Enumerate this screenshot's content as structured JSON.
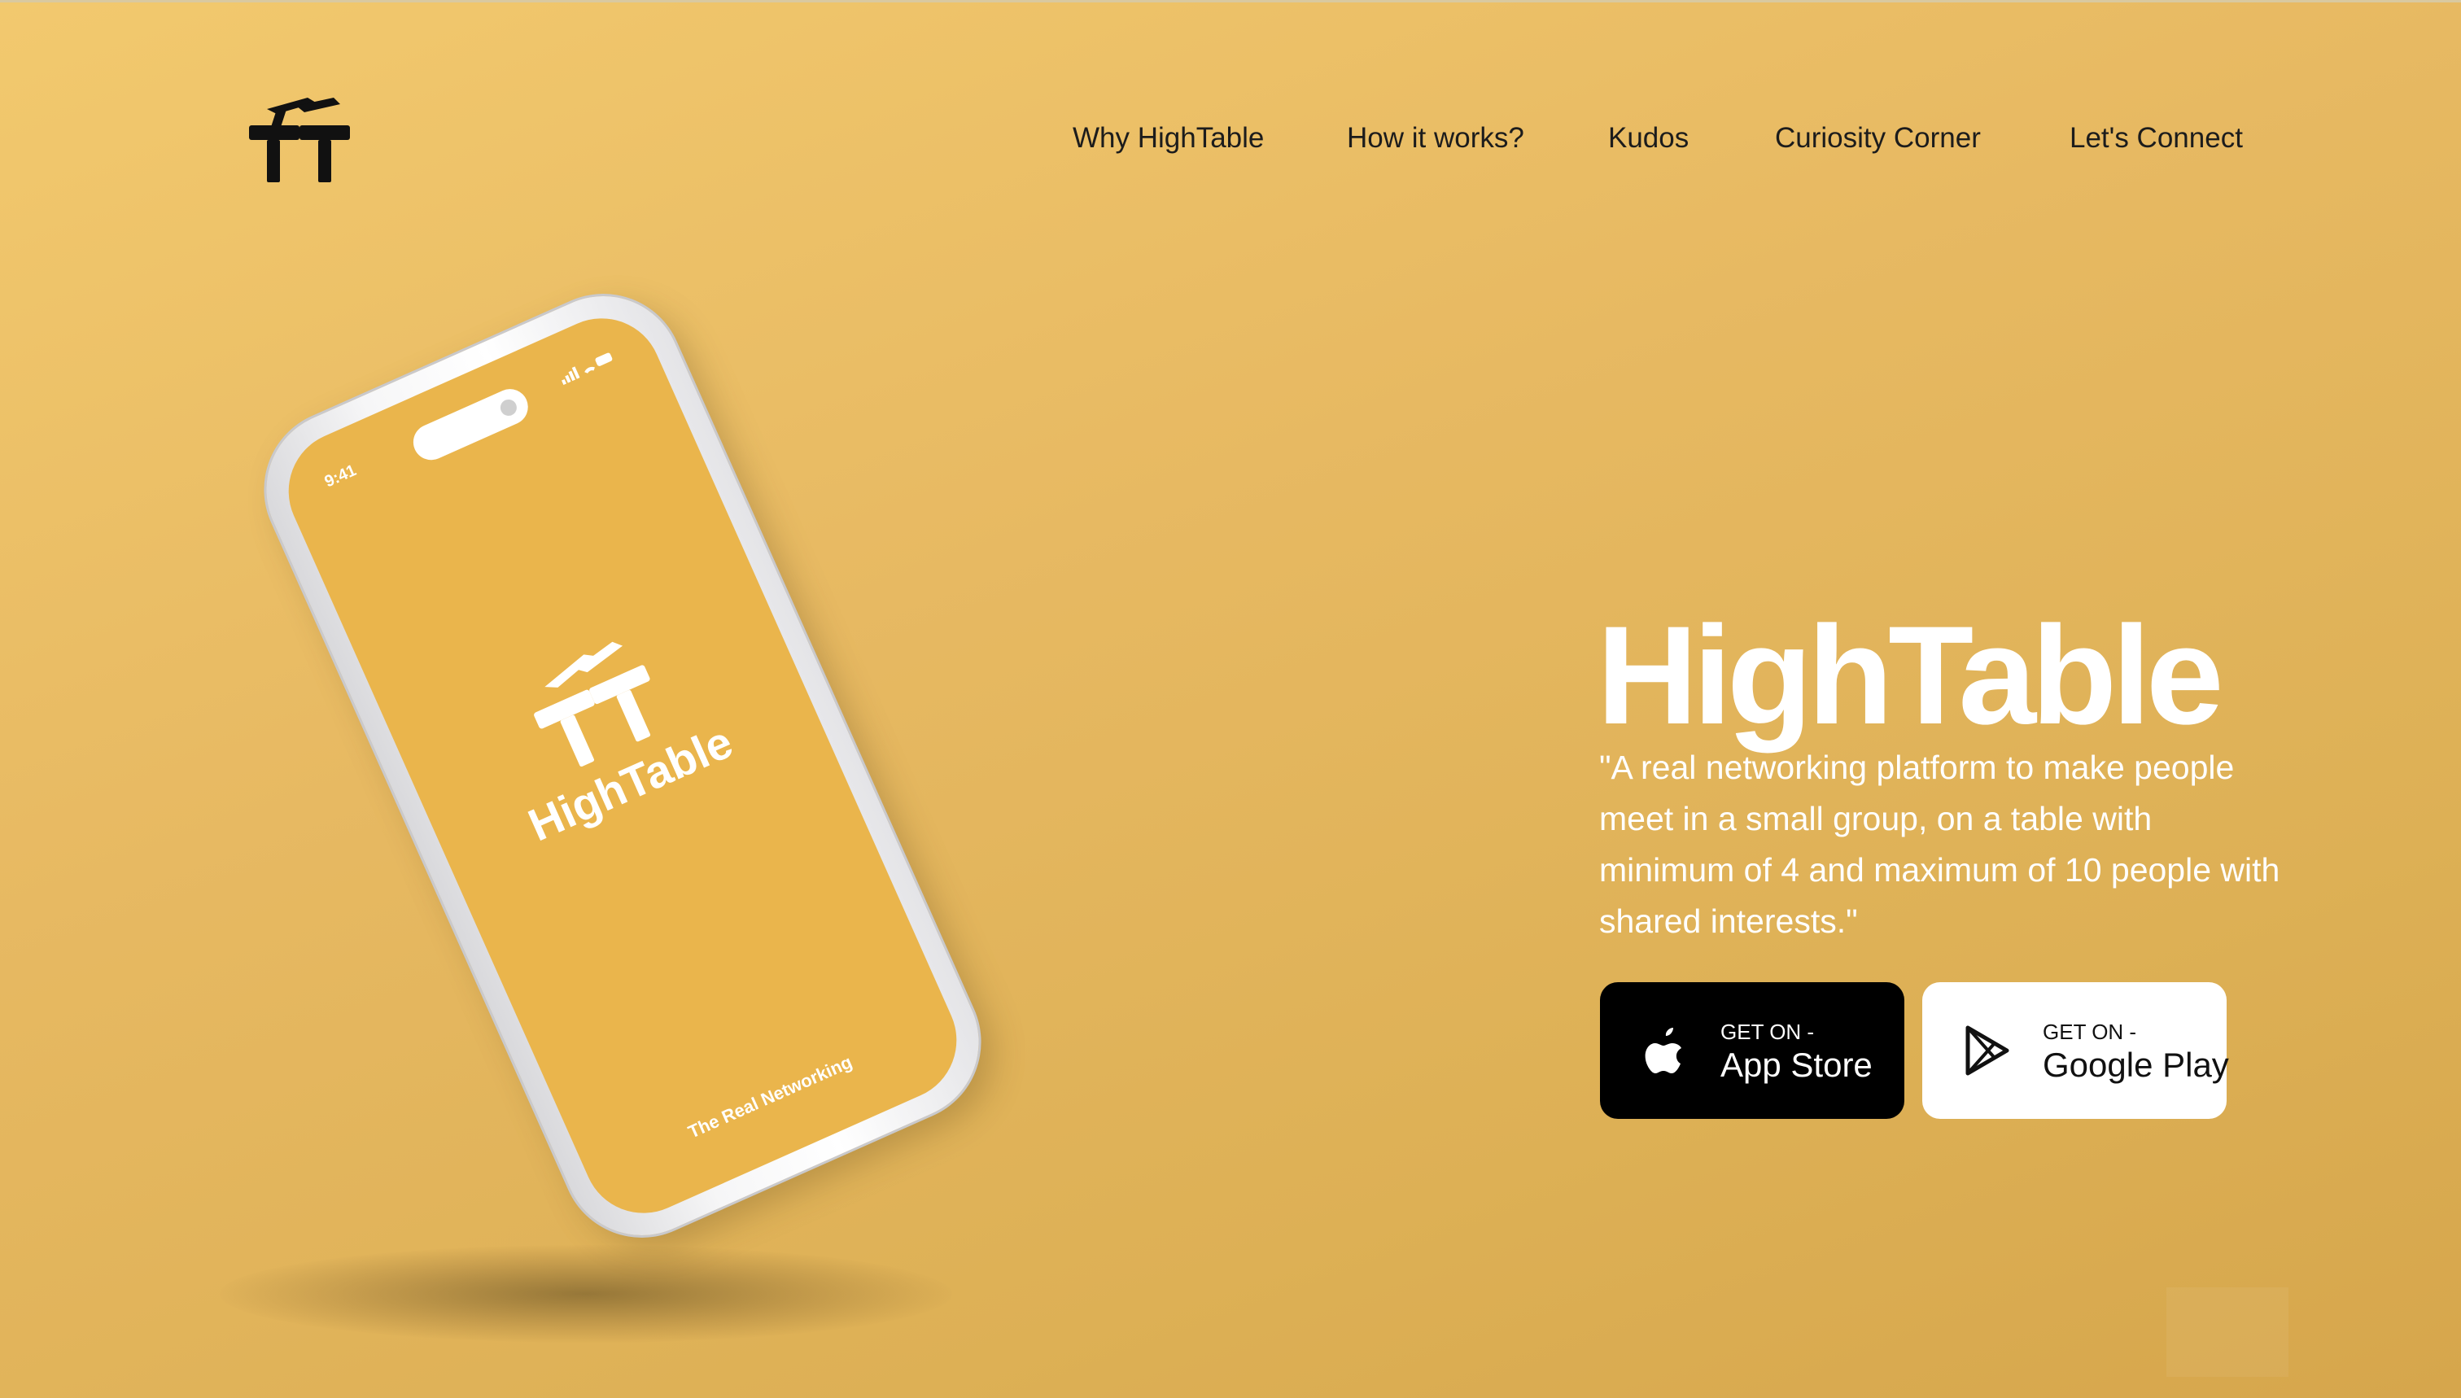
{
  "brand": {
    "name": "HighTable",
    "logo_icon": "hightable-logo-icon"
  },
  "nav": {
    "items": [
      {
        "label": "Why HighTable"
      },
      {
        "label": "How it works?"
      },
      {
        "label": "Kudos"
      },
      {
        "label": "Curiosity Corner"
      },
      {
        "label": "Let's Connect"
      }
    ]
  },
  "phone": {
    "time": "9:41",
    "brand": "HighTable",
    "tagline": "The Real Networking"
  },
  "hero": {
    "title": "HighTable",
    "description": "\"A real networking platform to make people meet in a small group, on a table with minimum of 4 and maximum of 10 people with shared interests.\""
  },
  "buttons": {
    "app_store": {
      "small": "GET ON -",
      "big": "App Store",
      "icon": "apple-icon"
    },
    "google_play": {
      "small": "GET ON -",
      "big": "Google Play",
      "icon": "google-play-icon"
    }
  },
  "colors": {
    "background": "#e7b962",
    "screen": "#eab54c",
    "accent_dark": "#000000",
    "text_light": "#ffffff"
  }
}
